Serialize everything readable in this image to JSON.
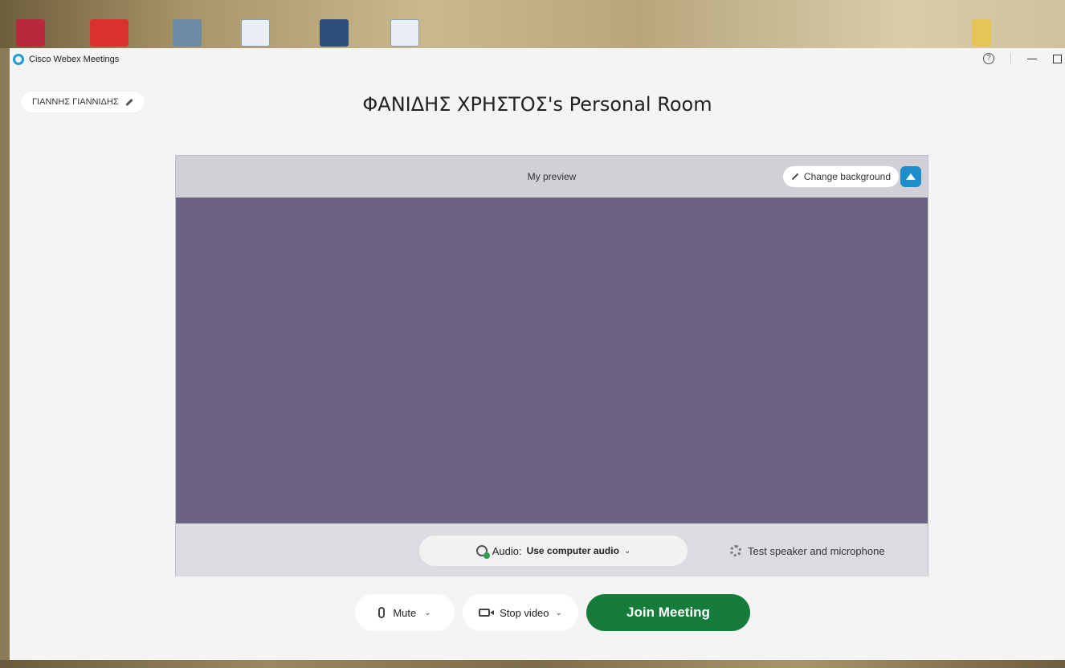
{
  "app": {
    "title": "Cisco Webex Meetings",
    "help_icon": "help-icon"
  },
  "user": {
    "name": "ΓΙΑΝΝΗΣ ΓΙΑΝΝΙΔΗΣ",
    "edit_icon": "pencil-icon"
  },
  "room": {
    "title": "ΦΑΝΙΔΗΣ ΧΡΗΣΤΟΣ's Personal Room"
  },
  "preview": {
    "label": "My preview",
    "change_background": "Change background",
    "upload_icon": "upload-icon"
  },
  "audio": {
    "prefix": "Audio:",
    "value": "Use computer audio",
    "test_label": "Test speaker and microphone"
  },
  "controls": {
    "mute_label": "Mute",
    "video_label": "Stop video",
    "join_label": "Join Meeting"
  },
  "colors": {
    "accent_blue": "#1f8dc9",
    "join_green": "#157c3b",
    "video_bg": "#6c6283"
  }
}
